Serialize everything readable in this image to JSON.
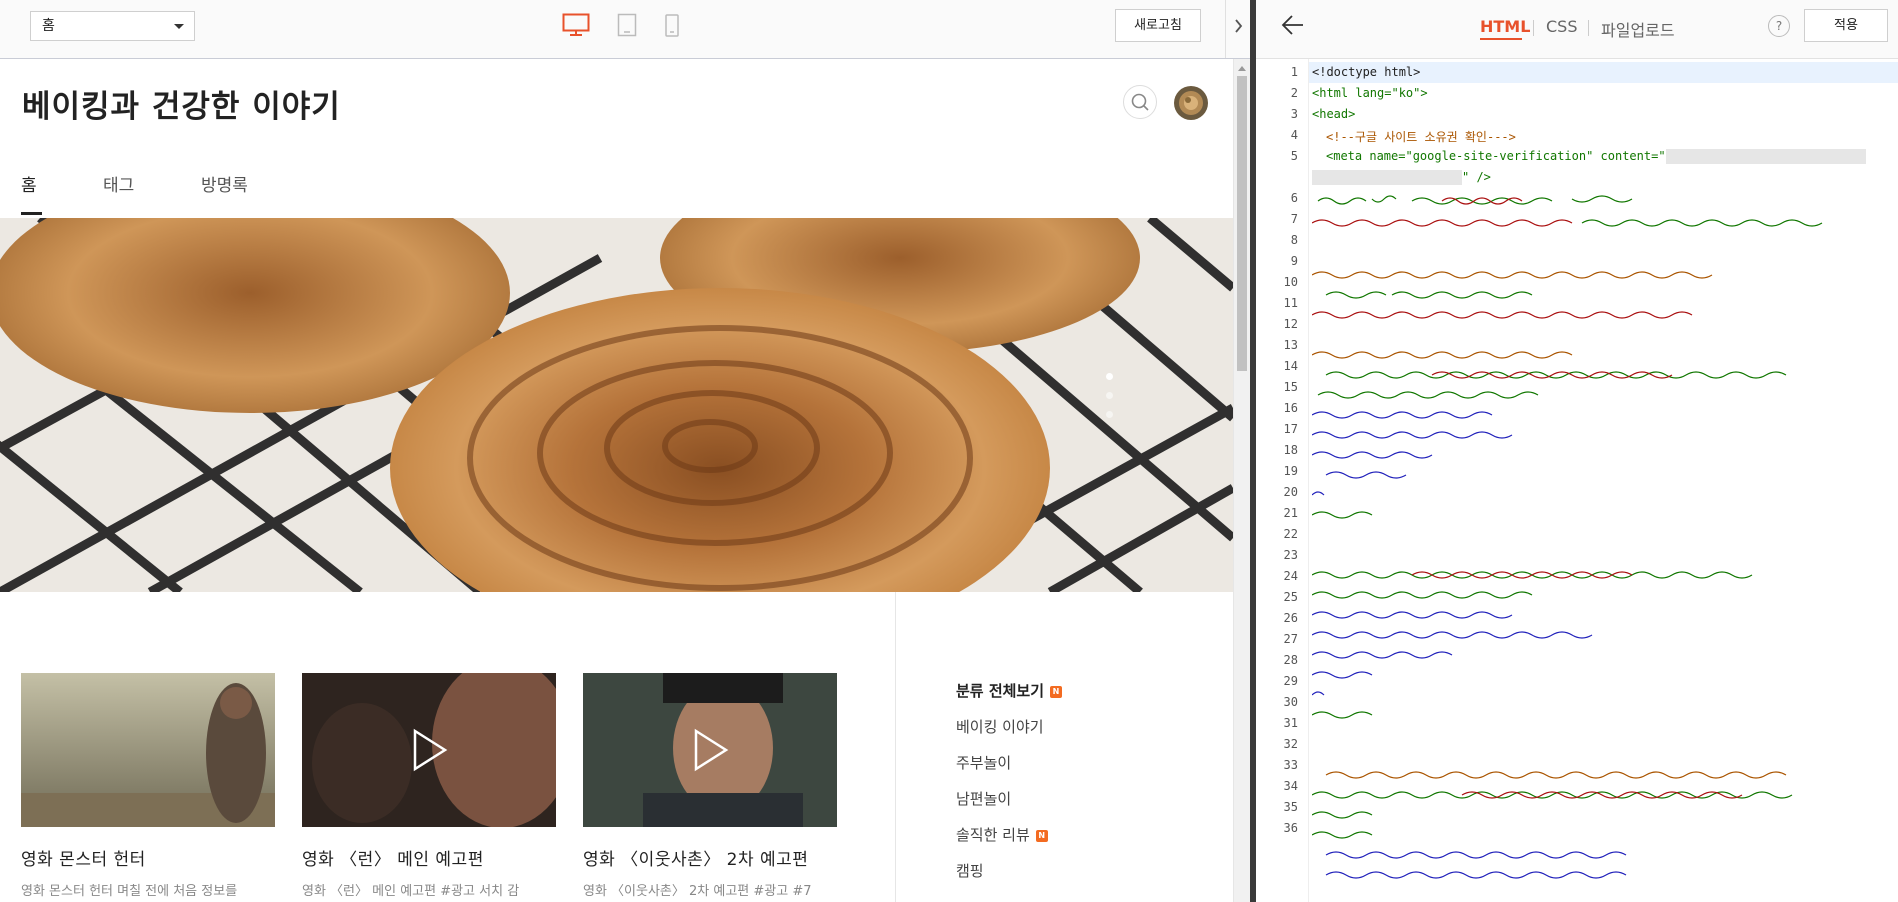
{
  "preview_toolbar": {
    "page_select": "홈",
    "refresh_label": "새로고침"
  },
  "blog": {
    "title": "베이킹과 건강한 이야기",
    "tabs": [
      "홈",
      "태그",
      "방명록"
    ]
  },
  "cards": [
    {
      "title": "영화 몬스터 헌터",
      "desc": "영화 몬스터 헌터 며칠 전에 처음 정보를"
    },
    {
      "title": "영화 〈런〉 메인 예고편",
      "desc": "영화 〈런〉 메인 예고편 #광고 서치 감"
    },
    {
      "title": "영화 〈이웃사촌〉 2차 예고편",
      "desc": "영화 〈이웃사촌〉 2차 예고편 #광고 #7"
    }
  ],
  "categories": [
    {
      "label": "분류 전체보기",
      "badge": "N"
    },
    {
      "label": "베이킹 이야기",
      "badge": ""
    },
    {
      "label": "주부놀이",
      "badge": ""
    },
    {
      "label": "남편놀이",
      "badge": ""
    },
    {
      "label": "솔직한 리뷰",
      "badge": "N"
    },
    {
      "label": "캠핑",
      "badge": ""
    }
  ],
  "editor_toolbar": {
    "tabs": [
      "HTML",
      "CSS",
      "파일업로드"
    ],
    "active_tab": "HTML",
    "help_label": "?",
    "apply_label": "적용"
  },
  "code_lines": [
    {
      "n": "1",
      "text": "<!doctype html>"
    },
    {
      "n": "2",
      "text": "<html lang=\"ko\">"
    },
    {
      "n": "3",
      "text": "<head>"
    },
    {
      "n": "4",
      "text": "<!--구글 사이트 소유권 확인--->"
    },
    {
      "n": "5",
      "text": "<meta name=\"google-site-verification\" content=\""
    },
    {
      "n": "",
      "text": "\" />"
    }
  ],
  "line_numbers": [
    "1",
    "2",
    "3",
    "4",
    "5",
    "6",
    "7",
    "8",
    "9",
    "10",
    "11",
    "12",
    "13",
    "14",
    "15",
    "16",
    "17",
    "18",
    "19",
    "20",
    "21",
    "22",
    "23",
    "24",
    "25",
    "26",
    "27",
    "28",
    "29",
    "30",
    "31",
    "32",
    "33",
    "34",
    "35",
    "36"
  ],
  "colors": {
    "accent": "#e8512b",
    "device_active": "#e8512b",
    "badge": "#f36b21"
  }
}
